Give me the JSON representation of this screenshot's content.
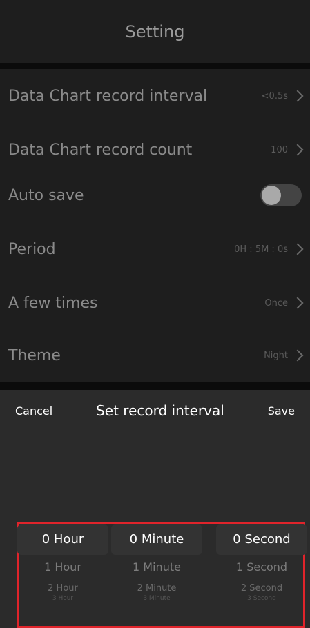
{
  "header": {
    "title": "Setting"
  },
  "group1": [
    {
      "label": "Data Chart record interval",
      "value": "<0.5s"
    },
    {
      "label": "Data Chart record count",
      "value": "100"
    }
  ],
  "group2": {
    "auto_save": {
      "label": "Auto save",
      "toggle": "off"
    },
    "period": {
      "label": "Period",
      "value": "0H : 5M : 0s"
    },
    "times": {
      "label": "A few times",
      "value": "Once"
    }
  },
  "group3": {
    "theme": {
      "label": "Theme",
      "value": "Night"
    }
  },
  "sheet": {
    "cancel": "Cancel",
    "title": "Set record interval",
    "save": "Save",
    "hours": [
      "0 Hour",
      "1 Hour",
      "2 Hour",
      "3 Hour"
    ],
    "minutes": [
      "0 Minute",
      "1 Minute",
      "2 Minute",
      "3 Minute"
    ],
    "seconds": [
      "0 Second",
      "1 Second",
      "2 Second",
      "3 Second"
    ]
  },
  "colors": {
    "highlight": "#e0242b",
    "sheet_bg": "#2b2b2b"
  }
}
